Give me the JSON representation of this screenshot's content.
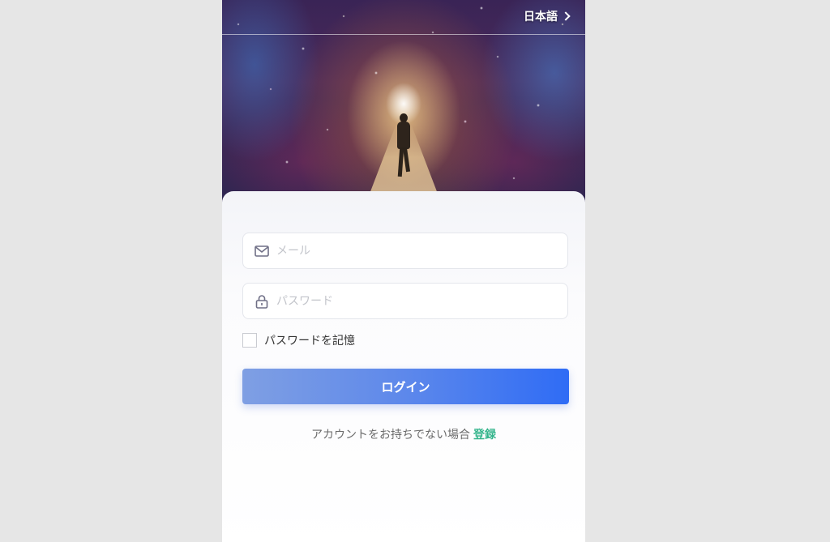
{
  "header": {
    "language_label": "日本語"
  },
  "form": {
    "email_placeholder": "メール",
    "password_placeholder": "パスワード",
    "remember_label": "パスワードを記憶",
    "remember_checked": false,
    "login_label": "ログイン"
  },
  "signup": {
    "prompt": "アカウントをお持ちでない場合",
    "link_label": "登録"
  },
  "icons": {
    "email": "envelope-icon",
    "password": "lock-icon",
    "language": "chevron-right-icon"
  },
  "colors": {
    "accent_start": "#7f9fe3",
    "accent_end": "#2f6cf5",
    "link": "#35b58c",
    "background": "#e6e6e6"
  }
}
